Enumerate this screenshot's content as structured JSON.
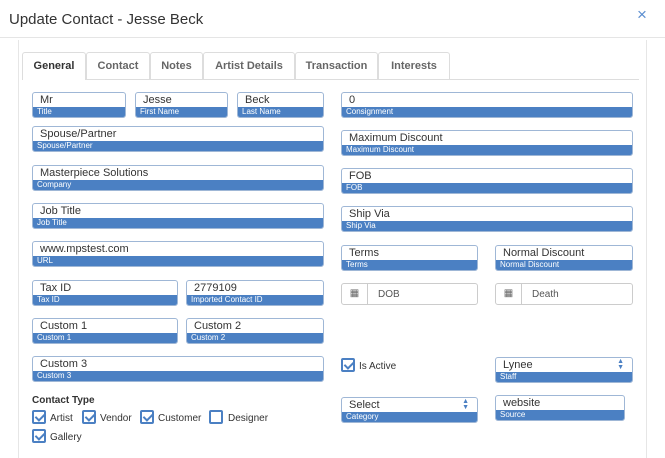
{
  "dialog": {
    "title": "Update Contact - Jesse Beck",
    "close_icon": "×"
  },
  "tabs": [
    "General",
    "Contact",
    "Notes",
    "Artist Details",
    "Transaction",
    "Interests"
  ],
  "fields": {
    "title": {
      "value": "Mr",
      "label": "Title"
    },
    "first_name": {
      "value": "Jesse",
      "label": "First Name"
    },
    "last_name": {
      "value": "Beck",
      "label": "Last Name"
    },
    "consignment": {
      "value": "0",
      "label": "Consignment"
    },
    "spouse": {
      "value": "Spouse/Partner",
      "label": "Spouse/Partner"
    },
    "max_discount": {
      "value": "Maximum Discount",
      "label": "Maximum Discount"
    },
    "company": {
      "value": "Masterpiece Solutions",
      "label": "Company"
    },
    "fob": {
      "value": "FOB",
      "label": "FOB"
    },
    "job_title": {
      "value": "Job Title",
      "label": "Job Title"
    },
    "ship_via": {
      "value": "Ship Via",
      "label": "Ship Via"
    },
    "url": {
      "value": "www.mpstest.com",
      "label": "URL"
    },
    "terms": {
      "value": "Terms",
      "label": "Terms"
    },
    "normal_discount": {
      "value": "Normal Discount",
      "label": "Normal Discount"
    },
    "tax_id": {
      "value": "Tax ID",
      "label": "Tax ID"
    },
    "imported_id": {
      "value": "2779109",
      "label": "Imported Contact ID"
    },
    "custom1": {
      "value": "Custom 1",
      "label": "Custom 1"
    },
    "custom2": {
      "value": "Custom 2",
      "label": "Custom 2"
    },
    "custom3": {
      "value": "Custom 3",
      "label": "Custom 3"
    },
    "staff": {
      "value": "Lynee",
      "label": "Staff"
    },
    "category": {
      "value": "Select",
      "label": "Category"
    },
    "source": {
      "value": "website",
      "label": "Source"
    }
  },
  "dates": {
    "dob": "DOB",
    "death": "Death"
  },
  "is_active": {
    "label": "Is Active",
    "checked": true
  },
  "contact_type": {
    "title": "Contact Type",
    "options": [
      {
        "label": "Artist",
        "checked": true
      },
      {
        "label": "Vendor",
        "checked": true
      },
      {
        "label": "Customer",
        "checked": true
      },
      {
        "label": "Designer",
        "checked": false
      },
      {
        "label": "Gallery",
        "checked": true
      }
    ]
  },
  "colors": {
    "accent": "#4b80c3",
    "border": "#9fb7d6"
  }
}
